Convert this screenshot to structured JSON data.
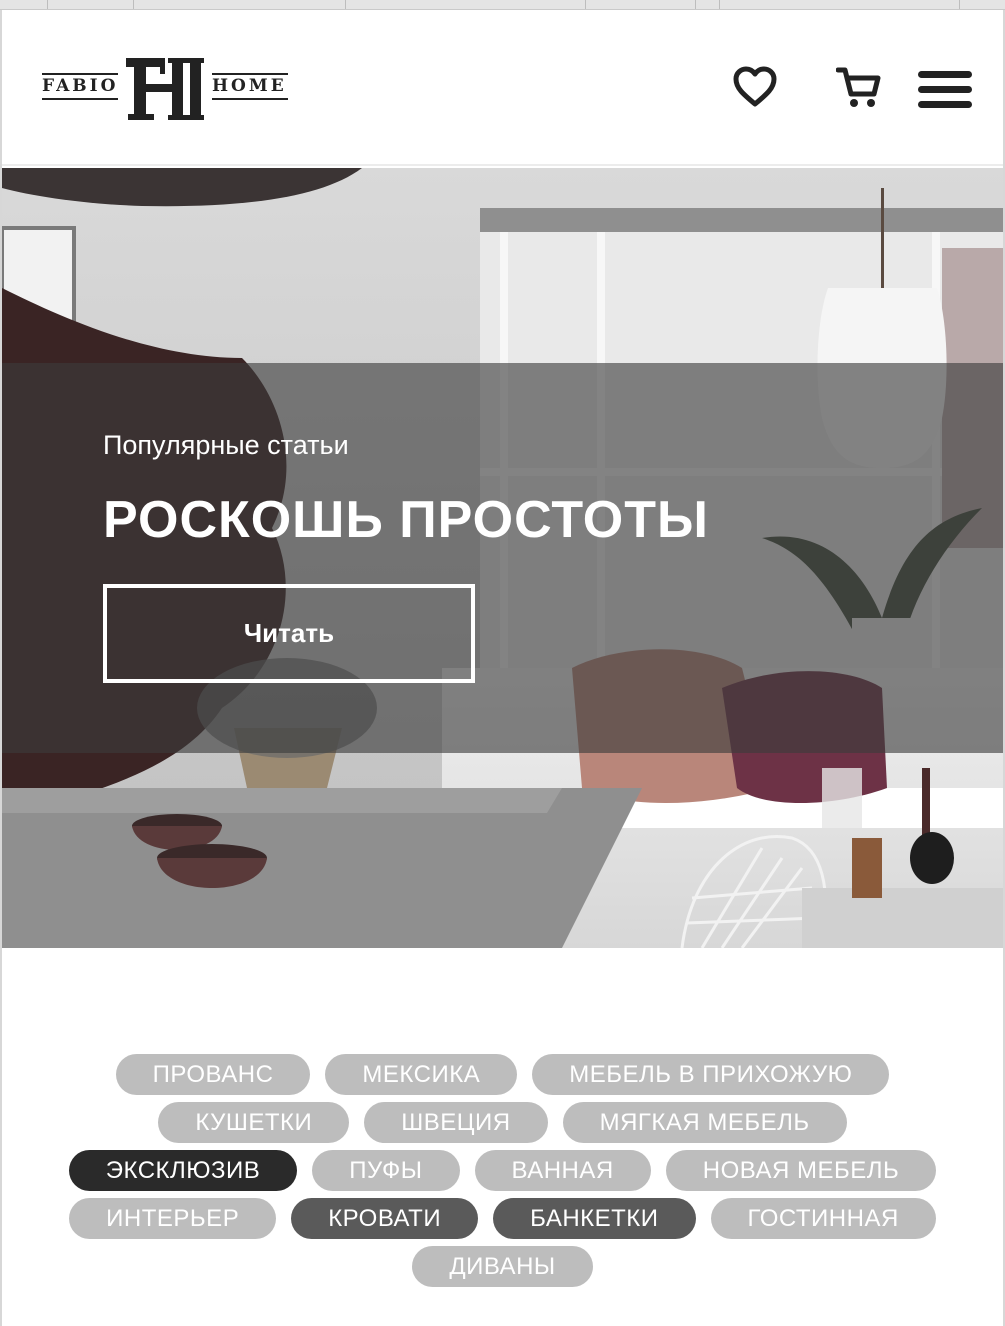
{
  "brand": {
    "left_word": "FABIO",
    "right_word": "HOME",
    "monogram": "FH"
  },
  "header": {
    "icons": [
      "heart-icon",
      "cart-icon",
      "menu-icon"
    ]
  },
  "hero": {
    "kicker": "Популярные статьи",
    "title": "РОСКОШЬ ПРОСТОТЫ",
    "button_label": "Читать"
  },
  "tags": {
    "rows": [
      [
        {
          "label": "ПРОВАНС",
          "style": "light"
        },
        {
          "label": "МЕКСИКА",
          "style": "light"
        },
        {
          "label": "МЕБЕЛЬ В ПРИХОЖУЮ",
          "style": "light"
        }
      ],
      [
        {
          "label": "КУШЕТКИ",
          "style": "light"
        },
        {
          "label": "ШВЕЦИЯ",
          "style": "light"
        },
        {
          "label": "МЯГКАЯ МЕБЕЛЬ",
          "style": "light"
        }
      ],
      [
        {
          "label": "ЭКСКЛЮЗИВ",
          "style": "darkest"
        },
        {
          "label": "ПУФЫ",
          "style": "light"
        },
        {
          "label": "ВАННАЯ",
          "style": "light"
        },
        {
          "label": "НОВАЯ МЕБЕЛЬ",
          "style": "light"
        }
      ],
      [
        {
          "label": "ИНТЕРЬЕР",
          "style": "light"
        },
        {
          "label": "КРОВАТИ",
          "style": "dark"
        },
        {
          "label": "БАНКЕТКИ",
          "style": "dark"
        },
        {
          "label": "ГОСТИННАЯ",
          "style": "light"
        }
      ],
      [
        {
          "label": "ДИВАНЫ",
          "style": "light"
        }
      ]
    ]
  },
  "colors": {
    "tag_light": "#bdbdbd",
    "tag_dark": "#5a5a5a",
    "tag_darkest": "#2a2a2a",
    "overlay": "#3c3c3c"
  }
}
